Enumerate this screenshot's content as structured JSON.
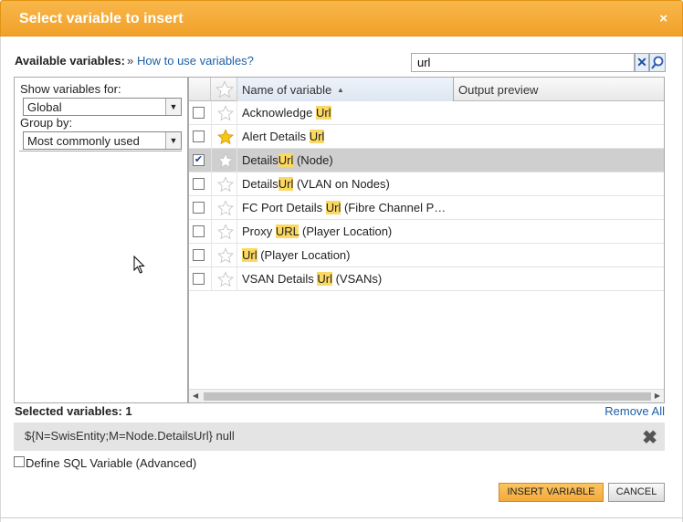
{
  "dialog": {
    "title": "Select variable to insert",
    "close_glyph": "×"
  },
  "header": {
    "available_label": "Available variables:",
    "raquo": "»",
    "howto_link": "How to use variables?",
    "search_value": "url"
  },
  "filters": {
    "show_for_label": "Show variables for:",
    "show_for_value": "Global",
    "group_by_label": "Group by:",
    "group_by_value": "Most commonly used"
  },
  "grid": {
    "columns": {
      "name": "Name of variable",
      "preview": "Output preview"
    },
    "rows": [
      {
        "pre": "Acknowledge ",
        "hl": "Url",
        "post": "",
        "checked": false,
        "favorite": false,
        "selected": false
      },
      {
        "pre": "Alert Details ",
        "hl": "Url",
        "post": "",
        "checked": false,
        "favorite": true,
        "selected": false
      },
      {
        "pre": "Details",
        "hl": "Url",
        "post": " (Node)",
        "checked": true,
        "favorite": false,
        "selected": true
      },
      {
        "pre": "Details",
        "hl": "Url",
        "post": " (VLAN on Nodes)",
        "checked": false,
        "favorite": false,
        "selected": false
      },
      {
        "pre": "FC Port Details ",
        "hl": "Url",
        "post": " (Fibre Channel P…",
        "checked": false,
        "favorite": false,
        "selected": false
      },
      {
        "pre": "Proxy ",
        "hl": "URL",
        "post": " (Player Location)",
        "checked": false,
        "favorite": false,
        "selected": false
      },
      {
        "pre": "",
        "hl": "Url",
        "post": " (Player Location)",
        "checked": false,
        "favorite": false,
        "selected": false
      },
      {
        "pre": "VSAN Details ",
        "hl": "Url",
        "post": " (VSANs)",
        "checked": false,
        "favorite": false,
        "selected": false
      }
    ]
  },
  "selection": {
    "label": "Selected variables: 1",
    "remove_all": "Remove All",
    "item_expr": "${N=SwisEntity;M=Node.DetailsUrl} null"
  },
  "sql": {
    "label": "Define SQL Variable (Advanced)"
  },
  "buttons": {
    "insert": "INSERT VARIABLE",
    "cancel": "CANCEL"
  },
  "colors": {
    "accent": "#f2a12a",
    "highlight": "#fbd862",
    "selected_row": "#cfcfcf",
    "link": "#1d5fa8"
  },
  "icons": {
    "clear": "clear-icon",
    "search": "search-icon",
    "star": "star-icon",
    "close": "close-icon",
    "cursor": "cursor-icon"
  }
}
